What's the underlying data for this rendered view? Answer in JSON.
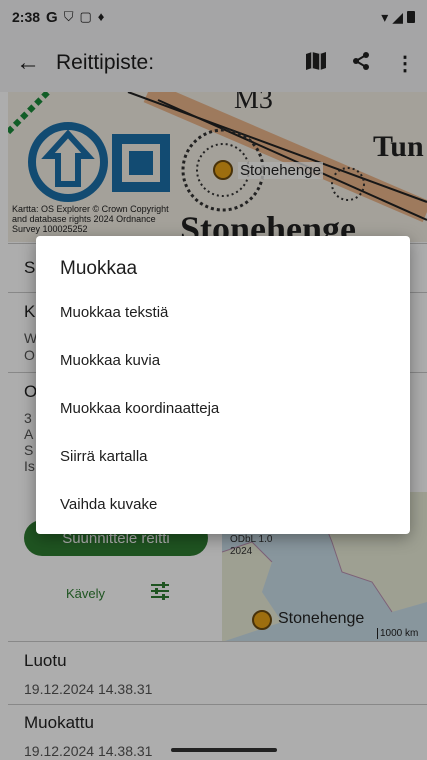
{
  "status": {
    "time": "2:38",
    "icons": [
      "google-g-icon",
      "shield-icon",
      "square-icon",
      "vibrate-icon"
    ],
    "right_icons": [
      "wifi-icon",
      "signal-icon",
      "battery-icon"
    ]
  },
  "appbar": {
    "title": "Reittipiste:",
    "actions": [
      "map-icon",
      "share-icon",
      "more-vert-icon"
    ]
  },
  "map": {
    "attribution_line1": "Kartta: OS Explorer © Crown Copyright",
    "attribution_line2": "and database rights 2024 Ordnance",
    "attribution_line3": "Survey 100025252",
    "marker_label": "Stonehenge",
    "map_text_top": "M3",
    "map_text_right": "Tun",
    "map_text_big": "Stonehenge"
  },
  "content": {
    "s_row": "S",
    "k_row": {
      "title": "K",
      "line1": "W",
      "line2": "O"
    },
    "o_row": {
      "title": "O",
      "lines": [
        "3",
        "A",
        "S",
        "Is"
      ]
    },
    "plan_button": "Suunnittele reitti",
    "mode_label": "Kävely",
    "small_map": {
      "marker_label": "Stonehenge",
      "scale": "1000 km",
      "odbl": "ODbL 1.0",
      "year": "2024"
    },
    "created": {
      "label": "Luotu",
      "value": "19.12.2024 14.38.31"
    },
    "modified": {
      "label": "Muokattu",
      "value": "19.12.2024 14.38.31"
    }
  },
  "dialog": {
    "title": "Muokkaa",
    "items": [
      "Muokkaa tekstiä",
      "Muokkaa kuvia",
      "Muokkaa koordinaatteja",
      "Siirrä kartalla",
      "Vaihda kuvake"
    ]
  },
  "colors": {
    "accent_green": "#2e7d32",
    "marker_orange": "#e8a317",
    "unesco_blue": "#1b6fa8"
  }
}
